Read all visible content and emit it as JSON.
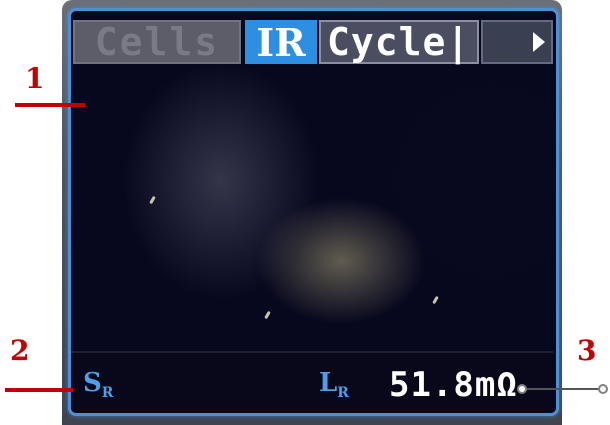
{
  "screen": {
    "tabs": [
      {
        "label": "Cells"
      },
      {
        "label": "IR"
      },
      {
        "label": "Cycle|"
      }
    ],
    "status": {
      "left_label_main": "S",
      "left_label_sub": "R",
      "right_label_main": "L",
      "right_label_sub": "R",
      "reading_value": "51.8mΩ"
    }
  },
  "annotations": {
    "marker_1": "1",
    "marker_2": "2",
    "marker_3": "3"
  },
  "colors": {
    "accent": "#2d8fe2",
    "label_blue": "#4f9fe6",
    "annotation_red": "#c40000"
  },
  "icons": {
    "tab_scroll": "chevron-right-icon"
  }
}
